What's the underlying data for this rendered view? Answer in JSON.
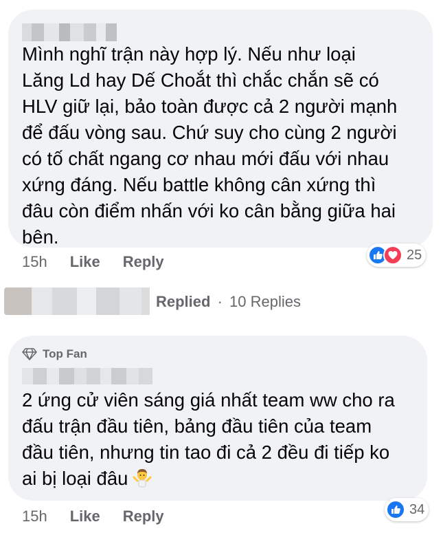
{
  "comment1": {
    "text": "Mình nghĩ trận này hợp lý. Nếu như loại\nLăng Ld hay Dế Choắt thì chắc chắn sẽ có\nHLV giữ lại, bảo toàn được cả 2 người mạnh\nđể đấu vòng sau. Chứ suy cho cùng 2 người\ncó tố chất ngang cơ nhau mới đấu với nhau\nxứng đáng. Nếu battle không cân xứng thì\nđâu còn điểm nhấn với ko cân bằng giữa hai\nbên.",
    "time": "15h",
    "like_label": "Like",
    "reply_label": "Reply",
    "reactions": [
      "like-icon",
      "love-icon"
    ],
    "reaction_count": "25"
  },
  "replies": {
    "label": "Replied",
    "separator": "·",
    "count_label": "10 Replies"
  },
  "comment2": {
    "badge": "Top Fan",
    "text": "2 ứng cử viên sáng giá nhất team ww cho ra\nđấu trận đầu tiên, bảng đầu tiên của team\nđầu tiên, nhưng tin tao đi cả 2 đều đi tiếp ko\nai bị loại đâu",
    "emoji": "shrugging-person-emoji",
    "time": "15h",
    "like_label": "Like",
    "reply_label": "Reply",
    "reactions": [
      "like-icon"
    ],
    "reaction_count": "34"
  },
  "colors": {
    "bubble": "#f0f2f5",
    "meta_text": "#65676b",
    "like_blue": "#1877f2",
    "love_red": "#f33e58"
  }
}
